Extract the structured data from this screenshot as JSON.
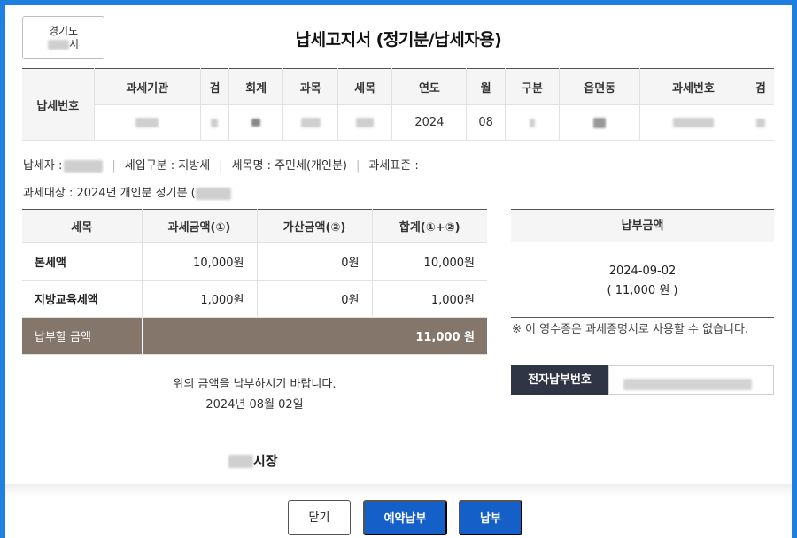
{
  "region": {
    "province": "경기도",
    "city_suffix": "시"
  },
  "title": "납세고지서 (정기분/납세자용)",
  "tax_number": {
    "row_label": "납세번호",
    "headers": [
      "과세기관",
      "검",
      "회계",
      "과목",
      "세목",
      "연도",
      "월",
      "구분",
      "읍면동",
      "과세번호",
      "검"
    ],
    "values": [
      "",
      "",
      "",
      "",
      "",
      "2024",
      "08",
      "",
      "",
      "",
      ""
    ]
  },
  "info": {
    "taxpayer_label": "납세자 :",
    "revenue_type": "세입구분 : 지방세",
    "tax_item_name": "세목명 : 주민세(개인분)",
    "tax_standard": "과세표준 :",
    "tax_target": "과세대상 : 2024년 개인분 정기분 ("
  },
  "amount_table": {
    "headers": [
      "세목",
      "과세금액(①)",
      "가산금액(②)",
      "합계(①+②)"
    ],
    "rows": [
      {
        "label": "본세액",
        "tax": "10,000원",
        "add": "0원",
        "sum": "10,000원"
      },
      {
        "label": "지방교육세액",
        "tax": "1,000원",
        "add": "0원",
        "sum": "1,000원"
      }
    ],
    "total_label": "납부할 금액",
    "total_value": "11,000 원"
  },
  "notice": {
    "message": "위의 금액을 납부하시기 바랍니다.",
    "date": "2024년 08월 02일"
  },
  "mayor_suffix": "시장",
  "payment": {
    "header": "납부금액",
    "due_date": "2024-09-02",
    "amount": "( 11,000 원 )",
    "warning": "※ 이 영수증은 과세증명서로 사용할 수 없습니다.",
    "enum_label": "전자납부번호"
  },
  "buttons": {
    "close": "닫기",
    "reserve": "예약납부",
    "pay": "납부"
  },
  "colors": {
    "total_bg": "#85766c",
    "primary": "#1560c8",
    "enum_bg": "#2f3545",
    "border": "#1e7fe0"
  }
}
